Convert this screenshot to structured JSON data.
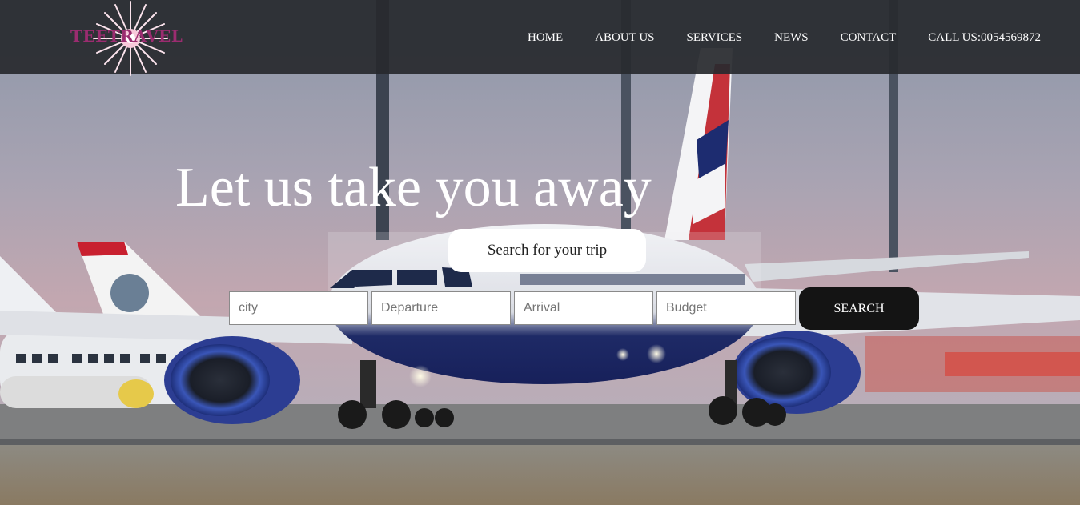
{
  "brand": {
    "logo_text": "TEETRAVEL",
    "logo_color": "#9b2c70"
  },
  "nav": {
    "items": [
      {
        "label": "HOME"
      },
      {
        "label": "ABOUT US"
      },
      {
        "label": "SERVICES"
      },
      {
        "label": "NEWS"
      },
      {
        "label": "CONTACT"
      },
      {
        "label": "CALL US:0054569872"
      }
    ]
  },
  "hero": {
    "headline": "Let us take you away",
    "search_prompt": "Search for your trip"
  },
  "search": {
    "city_placeholder": "city",
    "departure_placeholder": "Departure",
    "arrival_placeholder": "Arrival",
    "budget_placeholder": "Budget",
    "button_label": "SEARCH"
  },
  "colors": {
    "navbar_bg": "#282a2e",
    "button_bg": "#141414",
    "text_light": "#ffffff"
  }
}
